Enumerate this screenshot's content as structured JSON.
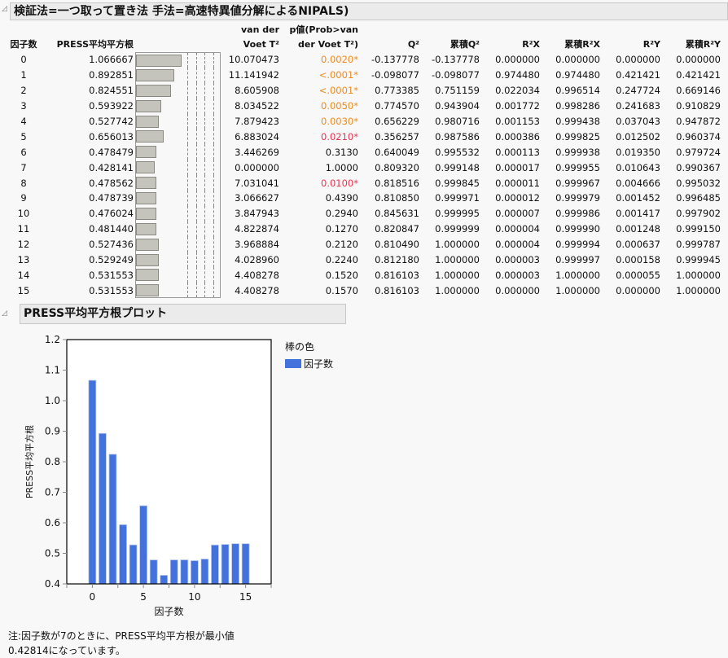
{
  "report": {
    "title": "検証法=一つ取って置き法 手法=高速特異値分解によるNIPALS)"
  },
  "table": {
    "headers": {
      "factors": "因子数",
      "press": "PRESS平均平方根",
      "vdv1": "van der",
      "vdv2": "Voet T²",
      "p1": "p値(Prob>van",
      "p2": "der Voet T²)",
      "q2": "Q²",
      "cumq2": "累積Q²",
      "r2x": "R²X",
      "cumr2x": "累積R²X",
      "r2y": "R²Y",
      "cumr2y": "累積R²Y"
    },
    "bar_scale_max": 2.0,
    "rows": [
      {
        "n": "0",
        "press": "1.066667",
        "pv": 1.066667,
        "t2": "10.070473",
        "p": "0.0020*",
        "pc": "orange",
        "q2": "-0.137778",
        "cq2": "-0.137778",
        "r2x": "0.000000",
        "cr2x": "0.000000",
        "r2y": "0.000000",
        "cr2y": "0.000000"
      },
      {
        "n": "1",
        "press": "0.892851",
        "pv": 0.892851,
        "t2": "11.141942",
        "p": "<.0001*",
        "pc": "orange",
        "q2": "-0.098077",
        "cq2": "-0.098077",
        "r2x": "0.974480",
        "cr2x": "0.974480",
        "r2y": "0.421421",
        "cr2y": "0.421421"
      },
      {
        "n": "2",
        "press": "0.824551",
        "pv": 0.824551,
        "t2": "8.605908",
        "p": "<.0001*",
        "pc": "orange",
        "q2": "0.773385",
        "cq2": "0.751159",
        "r2x": "0.022034",
        "cr2x": "0.996514",
        "r2y": "0.247724",
        "cr2y": "0.669146"
      },
      {
        "n": "3",
        "press": "0.593922",
        "pv": 0.593922,
        "t2": "8.034522",
        "p": "0.0050*",
        "pc": "orange",
        "q2": "0.774570",
        "cq2": "0.943904",
        "r2x": "0.001772",
        "cr2x": "0.998286",
        "r2y": "0.241683",
        "cr2y": "0.910829"
      },
      {
        "n": "4",
        "press": "0.527742",
        "pv": 0.527742,
        "t2": "7.879423",
        "p": "0.0030*",
        "pc": "orange",
        "q2": "0.656229",
        "cq2": "0.980716",
        "r2x": "0.001153",
        "cr2x": "0.999438",
        "r2y": "0.037043",
        "cr2y": "0.947872"
      },
      {
        "n": "5",
        "press": "0.656013",
        "pv": 0.656013,
        "t2": "6.883024",
        "p": "0.0210*",
        "pc": "red",
        "q2": "0.356257",
        "cq2": "0.987586",
        "r2x": "0.000386",
        "cr2x": "0.999825",
        "r2y": "0.012502",
        "cr2y": "0.960374"
      },
      {
        "n": "6",
        "press": "0.478479",
        "pv": 0.478479,
        "t2": "3.446269",
        "p": "0.3130",
        "pc": "",
        "q2": "0.640049",
        "cq2": "0.995532",
        "r2x": "0.000113",
        "cr2x": "0.999938",
        "r2y": "0.019350",
        "cr2y": "0.979724"
      },
      {
        "n": "7",
        "press": "0.428141",
        "pv": 0.428141,
        "t2": "0.000000",
        "p": "1.0000",
        "pc": "",
        "q2": "0.809320",
        "cq2": "0.999148",
        "r2x": "0.000017",
        "cr2x": "0.999955",
        "r2y": "0.010643",
        "cr2y": "0.990367"
      },
      {
        "n": "8",
        "press": "0.478562",
        "pv": 0.478562,
        "t2": "7.031041",
        "p": "0.0100*",
        "pc": "red",
        "q2": "0.818516",
        "cq2": "0.999845",
        "r2x": "0.000011",
        "cr2x": "0.999967",
        "r2y": "0.004666",
        "cr2y": "0.995032"
      },
      {
        "n": "9",
        "press": "0.478739",
        "pv": 0.478739,
        "t2": "3.066627",
        "p": "0.4390",
        "pc": "",
        "q2": "0.810850",
        "cq2": "0.999971",
        "r2x": "0.000012",
        "cr2x": "0.999979",
        "r2y": "0.001452",
        "cr2y": "0.996485"
      },
      {
        "n": "10",
        "press": "0.476024",
        "pv": 0.476024,
        "t2": "3.847943",
        "p": "0.2940",
        "pc": "",
        "q2": "0.845631",
        "cq2": "0.999995",
        "r2x": "0.000007",
        "cr2x": "0.999986",
        "r2y": "0.001417",
        "cr2y": "0.997902"
      },
      {
        "n": "11",
        "press": "0.481440",
        "pv": 0.48144,
        "t2": "4.822874",
        "p": "0.1270",
        "pc": "",
        "q2": "0.820847",
        "cq2": "0.999999",
        "r2x": "0.000004",
        "cr2x": "0.999990",
        "r2y": "0.001248",
        "cr2y": "0.999150"
      },
      {
        "n": "12",
        "press": "0.527436",
        "pv": 0.527436,
        "t2": "3.968884",
        "p": "0.2120",
        "pc": "",
        "q2": "0.810490",
        "cq2": "1.000000",
        "r2x": "0.000004",
        "cr2x": "0.999994",
        "r2y": "0.000637",
        "cr2y": "0.999787"
      },
      {
        "n": "13",
        "press": "0.529249",
        "pv": 0.529249,
        "t2": "4.028960",
        "p": "0.2240",
        "pc": "",
        "q2": "0.812180",
        "cq2": "1.000000",
        "r2x": "0.000003",
        "cr2x": "0.999997",
        "r2y": "0.000158",
        "cr2y": "0.999945"
      },
      {
        "n": "14",
        "press": "0.531553",
        "pv": 0.531553,
        "t2": "4.408278",
        "p": "0.1520",
        "pc": "",
        "q2": "0.816103",
        "cq2": "1.000000",
        "r2x": "0.000003",
        "cr2x": "1.000000",
        "r2y": "0.000055",
        "cr2y": "1.000000"
      },
      {
        "n": "15",
        "press": "0.531553",
        "pv": 0.531553,
        "t2": "4.408278",
        "p": "0.1570",
        "pc": "",
        "q2": "0.816103",
        "cq2": "1.000000",
        "r2x": "0.000000",
        "cr2x": "1.000000",
        "r2y": "0.000000",
        "cr2y": "1.000000"
      }
    ]
  },
  "plot": {
    "title": "PRESS平均平方根プロット"
  },
  "chart_data": {
    "type": "bar",
    "x": [
      0,
      1,
      2,
      3,
      4,
      5,
      6,
      7,
      8,
      9,
      10,
      11,
      12,
      13,
      14,
      15
    ],
    "values": [
      1.066667,
      0.892851,
      0.824551,
      0.593922,
      0.527742,
      0.656013,
      0.478479,
      0.428141,
      0.478562,
      0.478739,
      0.476024,
      0.48144,
      0.527436,
      0.529249,
      0.531553,
      0.531553
    ],
    "xlabel": "因子数",
    "ylabel": "PRESS平均平方根",
    "xlim": [
      -2.5,
      17.5
    ],
    "ylim": [
      0.4,
      1.2
    ],
    "xticks": [
      "0",
      "5",
      "10",
      "15"
    ],
    "yticks": [
      "0.4",
      "0.5",
      "0.6",
      "0.7",
      "0.8",
      "0.9",
      "1.0",
      "1.1",
      "1.2"
    ],
    "legend_title": "棒の色",
    "legend_label": "因子数",
    "color": "#4472dc"
  },
  "note": "注:因子数が7のときに、PRESS平均平方根が最小値0.42814になっています。"
}
